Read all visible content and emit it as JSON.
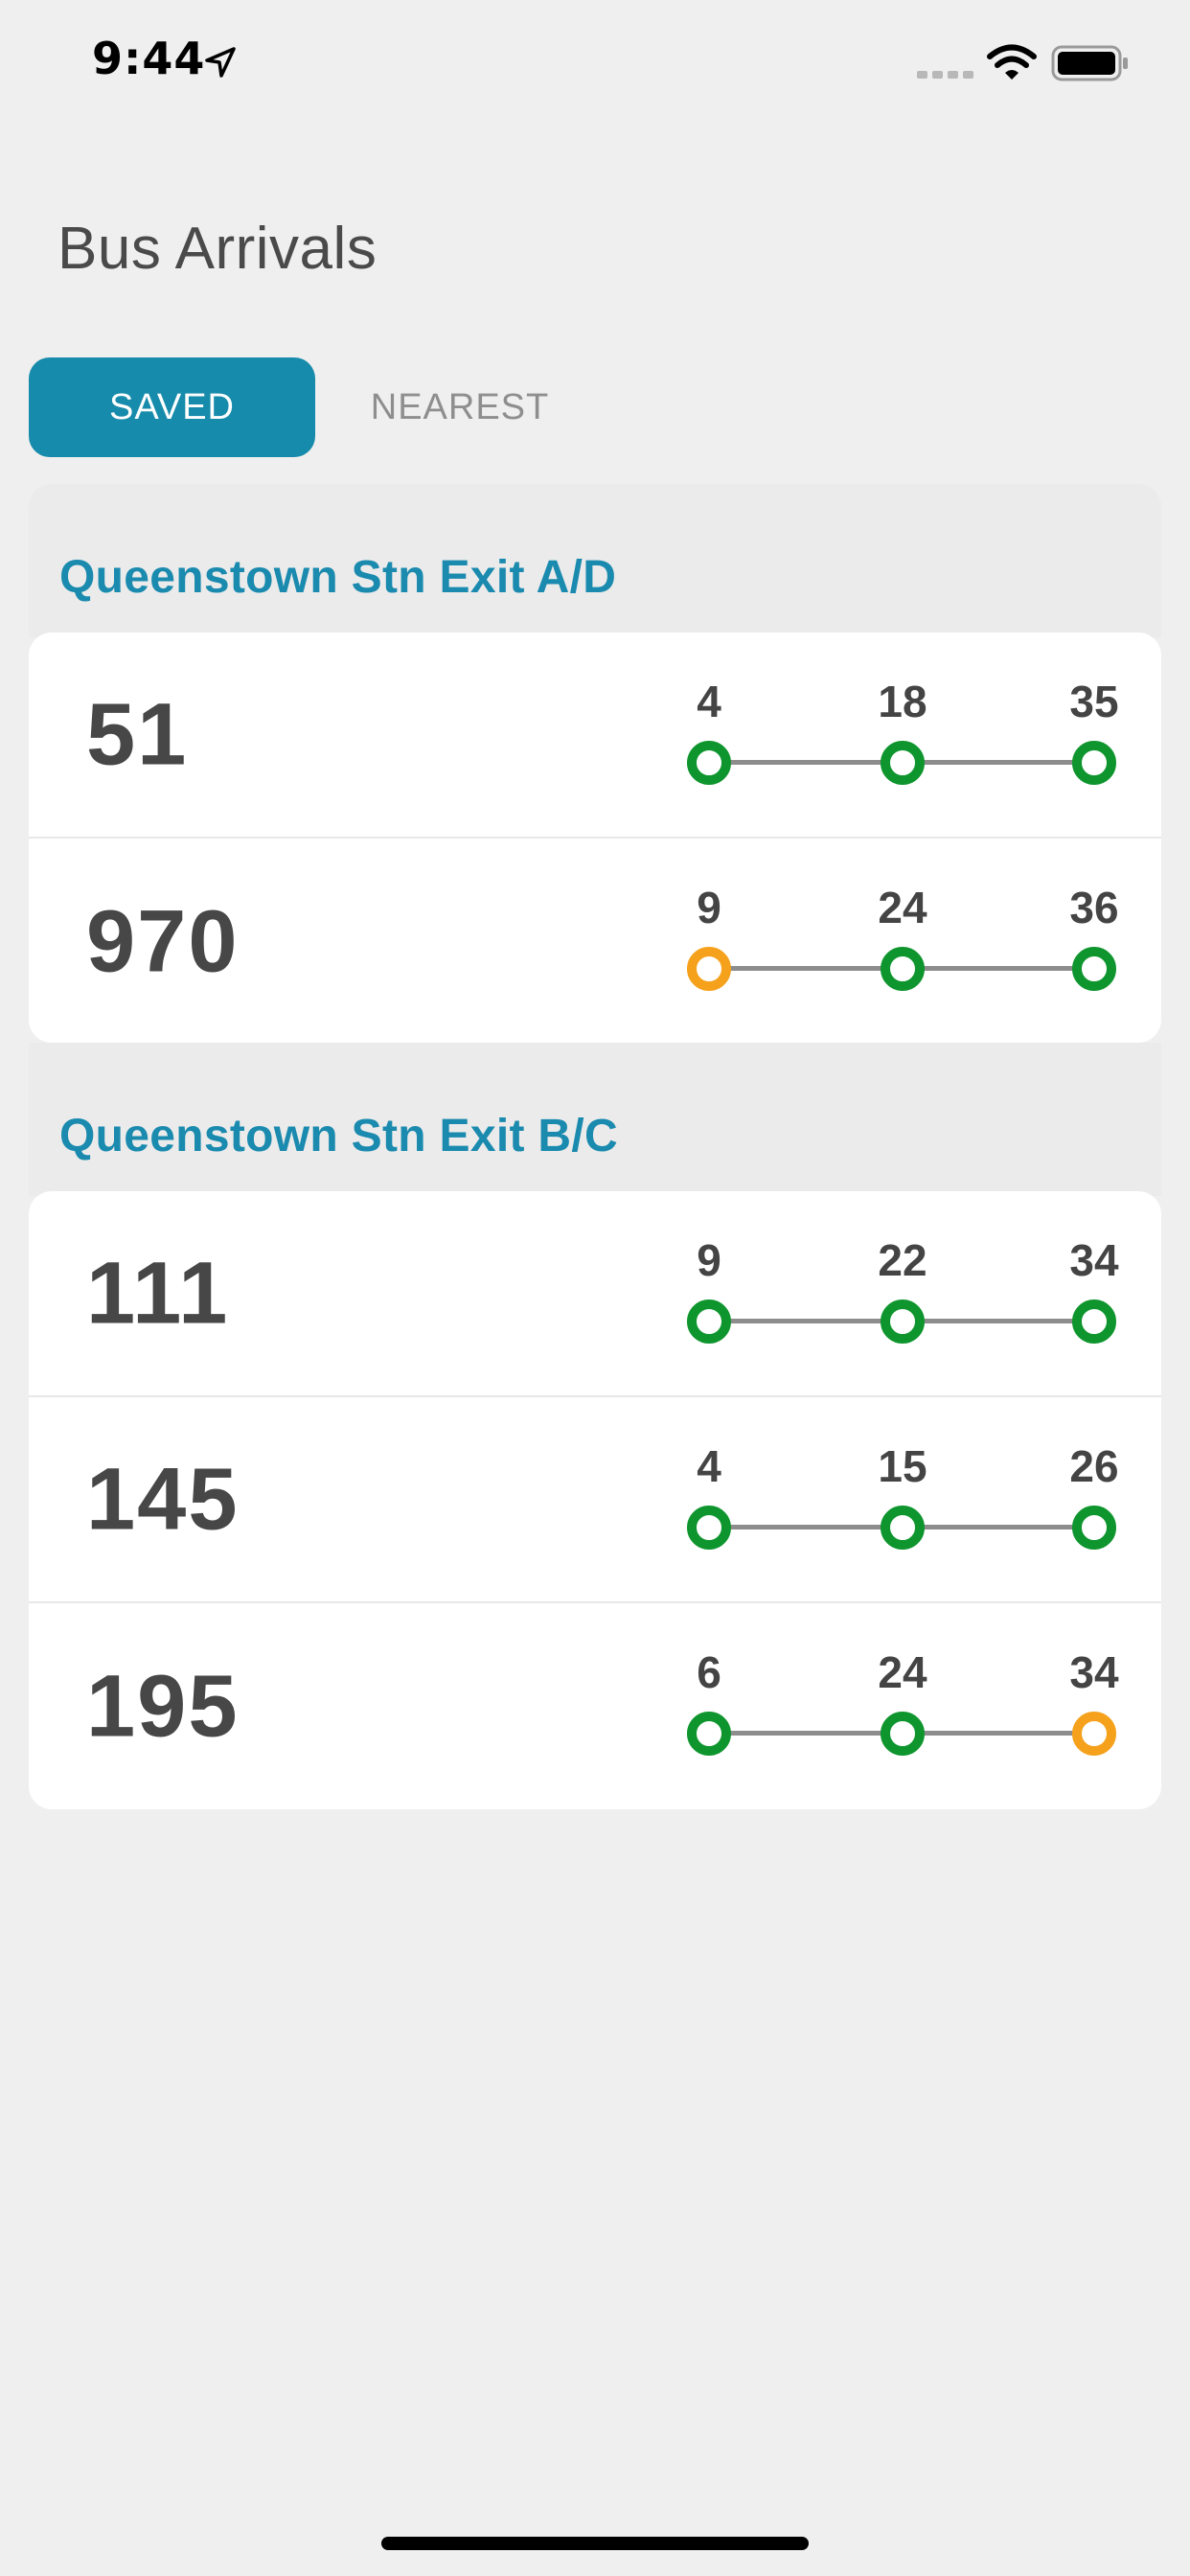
{
  "status_bar": {
    "time": "9:44"
  },
  "title": "Bus Arrivals",
  "tabs": {
    "saved": "SAVED",
    "nearest": "NEAREST"
  },
  "colors": {
    "accent": "#168bab",
    "on_time": "#0f952e",
    "warning": "#f5a11b",
    "line": "#8d8d8d"
  },
  "groups": [
    {
      "name": "Queenstown Stn Exit A/D",
      "services": [
        {
          "bus": "51",
          "arrivals": [
            {
              "eta": "4",
              "status": "green"
            },
            {
              "eta": "18",
              "status": "green"
            },
            {
              "eta": "35",
              "status": "green"
            }
          ]
        },
        {
          "bus": "970",
          "arrivals": [
            {
              "eta": "9",
              "status": "orange"
            },
            {
              "eta": "24",
              "status": "green"
            },
            {
              "eta": "36",
              "status": "green"
            }
          ]
        }
      ]
    },
    {
      "name": "Queenstown Stn Exit B/C",
      "services": [
        {
          "bus": "111",
          "arrivals": [
            {
              "eta": "9",
              "status": "green"
            },
            {
              "eta": "22",
              "status": "green"
            },
            {
              "eta": "34",
              "status": "green"
            }
          ]
        },
        {
          "bus": "145",
          "arrivals": [
            {
              "eta": "4",
              "status": "green"
            },
            {
              "eta": "15",
              "status": "green"
            },
            {
              "eta": "26",
              "status": "green"
            }
          ]
        },
        {
          "bus": "195",
          "arrivals": [
            {
              "eta": "6",
              "status": "green"
            },
            {
              "eta": "24",
              "status": "green"
            },
            {
              "eta": "34",
              "status": "orange"
            }
          ]
        }
      ]
    }
  ]
}
